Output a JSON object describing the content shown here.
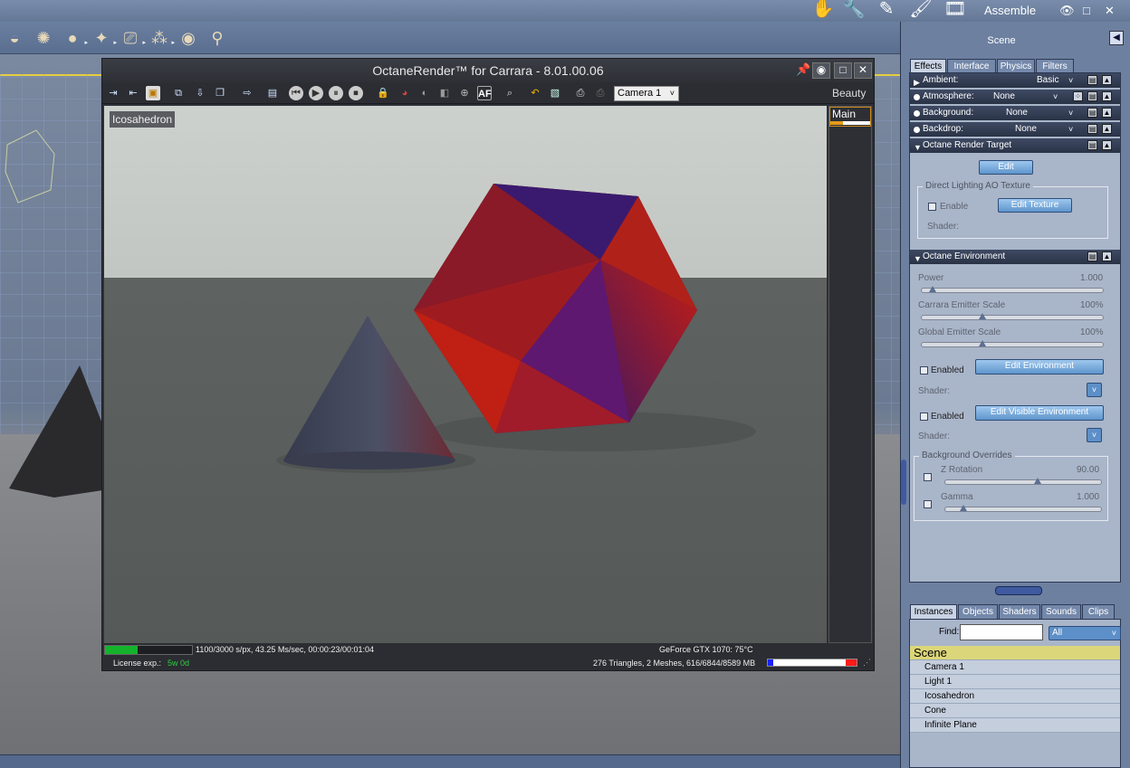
{
  "toolbar": {
    "room_label": "Assemble",
    "tools": [
      "hand-tool-icon",
      "wrench-icon",
      "pen-icon",
      "paintbrush-icon",
      "filmstrip-icon"
    ],
    "assemble_tools": [
      "teapot-icon",
      "gear-icon",
      "sphere-icon",
      "spot-light-icon",
      "camera-icon",
      "molecule-icon",
      "target-icon",
      "bone-icon"
    ]
  },
  "octane": {
    "title": "OctaneRender™ for Carrara - 8.01.00.06",
    "camera_select": "Camera 1",
    "pass_label": "Beauty",
    "object_label": "Icosahedron",
    "main_panel_label": "Main",
    "status": {
      "samples": "1100/3000 s/px, 43.25 Ms/sec, 00:00:23/00:01:04",
      "gpu": "GeForce GTX 1070: 75°C",
      "license_label": "License exp.:",
      "license_value": "5w 0d",
      "scene_info": "276 Triangles, 2 Meshes, 616/6844/8589 MB",
      "progress_fraction": 0.37
    }
  },
  "panel": {
    "title": "Scene",
    "tabs": [
      "Effects",
      "Interface",
      "Physics",
      "Filters"
    ],
    "rows": {
      "ambient": {
        "label": "Ambient:",
        "value": "Basic"
      },
      "atmosphere": {
        "label": "Atmosphere:",
        "value": "None"
      },
      "background": {
        "label": "Background:",
        "value": "None"
      },
      "backdrop": {
        "label": "Backdrop:",
        "value": "None"
      },
      "render_target": {
        "label": "Octane Render Target"
      }
    },
    "edit_button": "Edit",
    "ao_group": {
      "title": "Direct Lighting AO Texture",
      "enable": "Enable",
      "edit_texture": "Edit Texture",
      "shader": "Shader:"
    },
    "environment": {
      "title": "Octane Environment",
      "power": {
        "label": "Power",
        "value": "1.000",
        "level": 0.04
      },
      "carrara_scale": {
        "label": "Carrara Emitter Scale",
        "value": "100%",
        "level": 0.33
      },
      "global_scale": {
        "label": "Global Emitter Scale",
        "value": "100%",
        "level": 0.33
      },
      "enabled1": "Enabled",
      "edit_env": "Edit Environment",
      "shader1": "Shader:",
      "enabled2": "Enabled",
      "edit_visible": "Edit Visible Environment",
      "shader2": "Shader:",
      "overrides": {
        "title": "Background Overrides",
        "z_rotation": {
          "label": "Z Rotation",
          "value": "90.00",
          "level": 0.6
        },
        "gamma": {
          "label": "Gamma",
          "value": "1.000",
          "level": 0.1
        }
      }
    }
  },
  "instances": {
    "tabs": [
      "Instances",
      "Objects",
      "Shaders",
      "Sounds",
      "Clips"
    ],
    "find_label": "Find:",
    "filter": "All",
    "scene_root": "Scene",
    "items": [
      "Camera 1",
      "Light 1",
      "Icosahedron",
      "Cone",
      "Infinite Plane"
    ]
  },
  "colors": {
    "accent": "#e49a18",
    "progress": "#14b32b",
    "scene_highlight": "#dcd67a"
  }
}
